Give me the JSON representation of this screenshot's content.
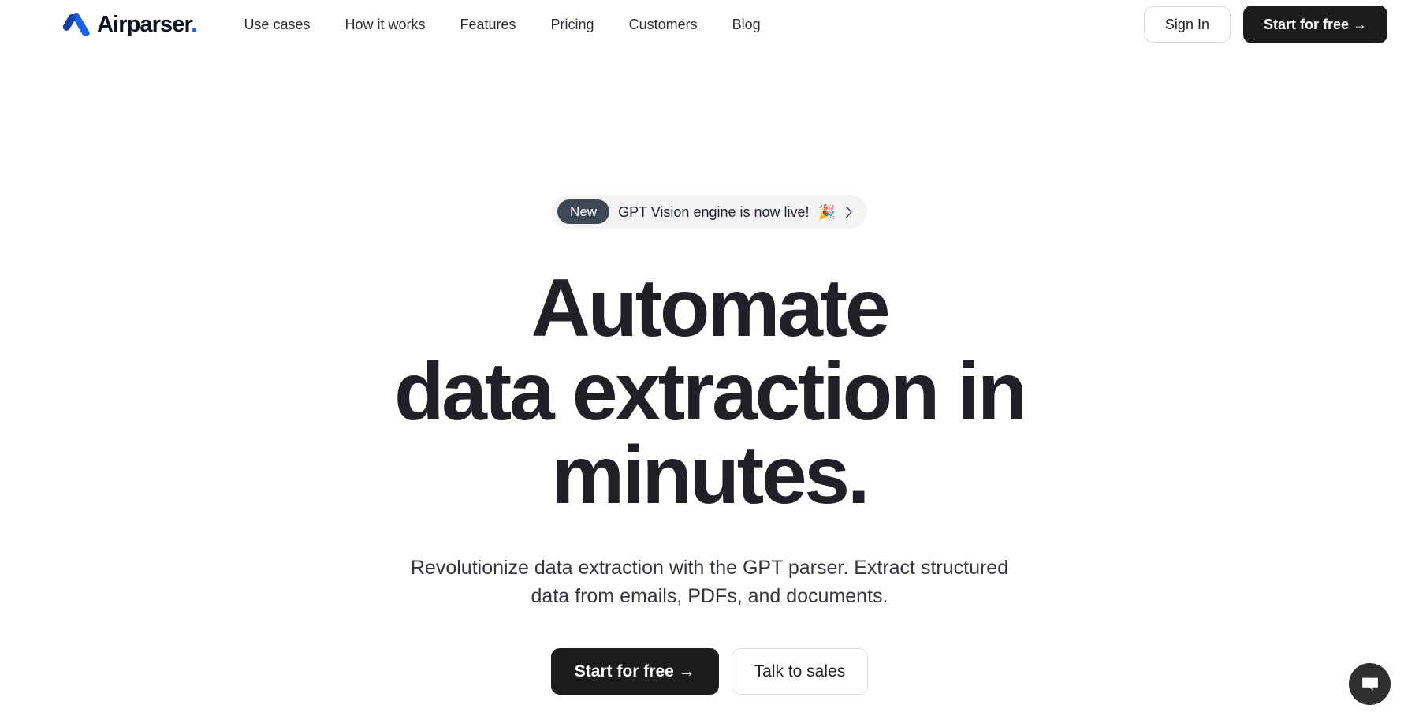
{
  "brand": {
    "name": "Airparser",
    "dot": ".",
    "logo_icon": "airparser-chevron-logo",
    "colors": {
      "mark_dark": "#0f3fa8",
      "mark_light": "#1a62f0",
      "dot": "#1a62f0"
    }
  },
  "nav": {
    "items": [
      {
        "label": "Use cases"
      },
      {
        "label": "How it works"
      },
      {
        "label": "Features"
      },
      {
        "label": "Pricing"
      },
      {
        "label": "Customers"
      },
      {
        "label": "Blog"
      }
    ]
  },
  "header_actions": {
    "sign_in": "Sign In",
    "start_free": "Start for free →"
  },
  "announcement": {
    "badge": "New",
    "text": "GPT Vision engine is now live!",
    "emoji": "🎉",
    "chevron_icon": "chevron-right-icon"
  },
  "hero": {
    "headline_lines": [
      "Automate",
      "data extraction in",
      "minutes."
    ],
    "subheadline": "Revolutionize data extraction with the GPT parser. Extract structured data from emails, PDFs, and documents.",
    "primary_cta": "Start for free →",
    "secondary_cta": "Talk to sales"
  },
  "chat_widget": {
    "icon": "chat-bubble-icon",
    "color": "#2f2f31"
  },
  "theme": {
    "background": "#ffffff",
    "text": "#1d1f23",
    "dark_button": "#1c1c1e",
    "badge_dark": "#3f4654",
    "announce_bg": "#f3f4f6",
    "border": "#d9dade"
  }
}
